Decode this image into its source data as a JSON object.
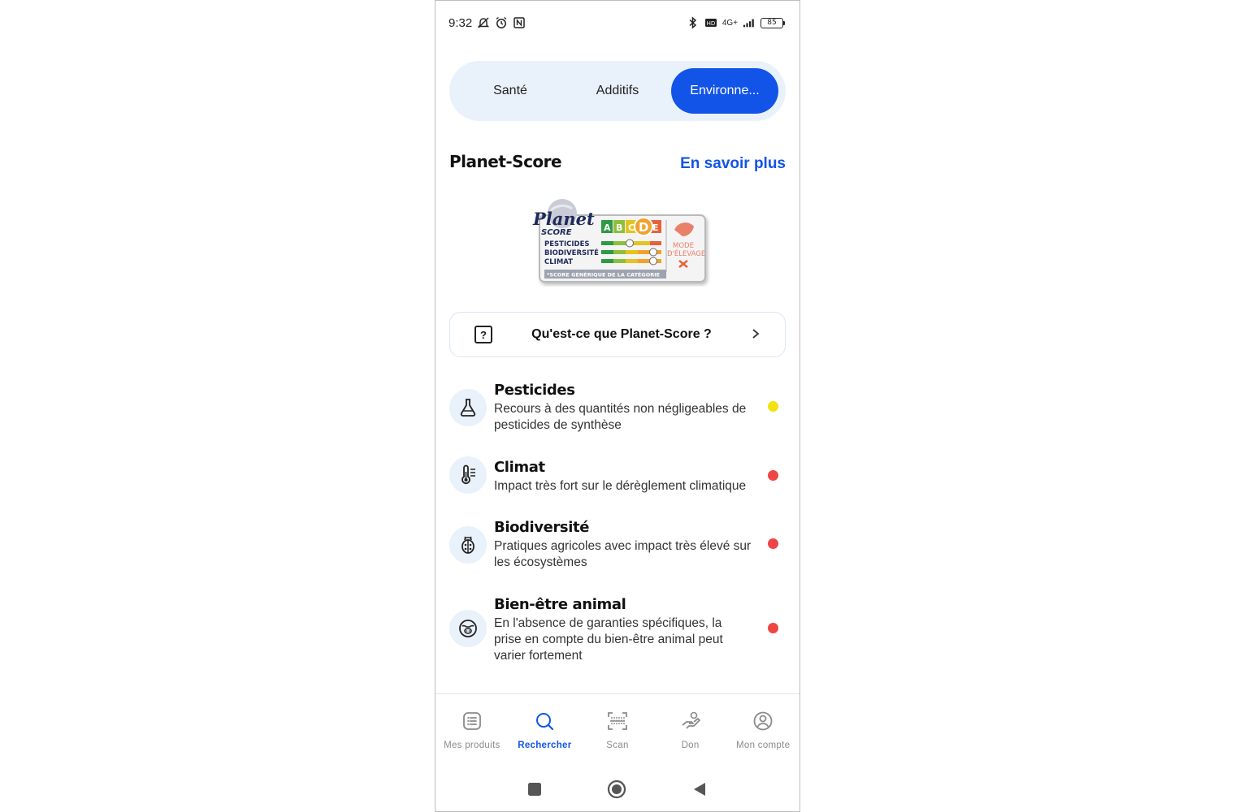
{
  "status_bar": {
    "time": "9:32",
    "network": "4G+",
    "battery": "85",
    "icons": [
      "mute-icon",
      "alarm-icon",
      "nfc-icon",
      "bluetooth-icon",
      "vowifi-icon",
      "signal-icon",
      "battery-icon"
    ]
  },
  "tabs": [
    {
      "label": "Santé",
      "active": false
    },
    {
      "label": "Additifs",
      "active": false
    },
    {
      "label": "Environne...",
      "active": true
    }
  ],
  "section": {
    "title": "Planet-Score",
    "link": "En savoir plus"
  },
  "planet_score_logo": {
    "brand": "Planet",
    "score_word": "SCORE",
    "grades": [
      "A",
      "B",
      "C",
      "D",
      "E"
    ],
    "selected_grade": "D",
    "rows": [
      "PESTICIDES",
      "BIODIVERSITÉ",
      "CLIMAT"
    ],
    "mode_label_1": "MODE",
    "mode_label_2": "D'ÉLEVAGE",
    "footer": "*SCORE GÉNÉRIQUE DE LA CATÉGORIE"
  },
  "question_card": {
    "icon_glyph": "?",
    "label": "Qu'est-ce que Planet-Score ?"
  },
  "criteria": [
    {
      "icon": "flask-icon",
      "title": "Pesticides",
      "description": "Recours à des quantités non négligeables de pesticides de synthèse",
      "status_color": "#f2e20f"
    },
    {
      "icon": "thermometer-icon",
      "title": "Climat",
      "description": "Impact très fort sur le dérèglement climatique",
      "status_color": "#ee4545"
    },
    {
      "icon": "ladybug-icon",
      "title": "Biodiversité",
      "description": "Pratiques agricoles avec impact très élevé sur les écosystèmes",
      "status_color": "#ee4545"
    },
    {
      "icon": "cow-icon",
      "title": "Bien-être animal",
      "description": "En l'absence de garanties spécifiques, la prise en compte du bien-être animal peut varier fortement",
      "status_color": "#ee4545"
    }
  ],
  "bottom_nav": [
    {
      "label": "Mes produits",
      "icon": "list-icon",
      "active": false
    },
    {
      "label": "Rechercher",
      "icon": "search-icon",
      "active": true
    },
    {
      "label": "Scan",
      "icon": "barcode-scan-icon",
      "active": false
    },
    {
      "label": "Don",
      "icon": "donate-hand-icon",
      "active": false
    },
    {
      "label": "Mon compte",
      "icon": "account-icon",
      "active": false
    }
  ],
  "colors": {
    "accent": "#1254e8",
    "tab_track": "#e9f1fb",
    "yellow_status": "#f2e20f",
    "red_status": "#ee4545"
  }
}
